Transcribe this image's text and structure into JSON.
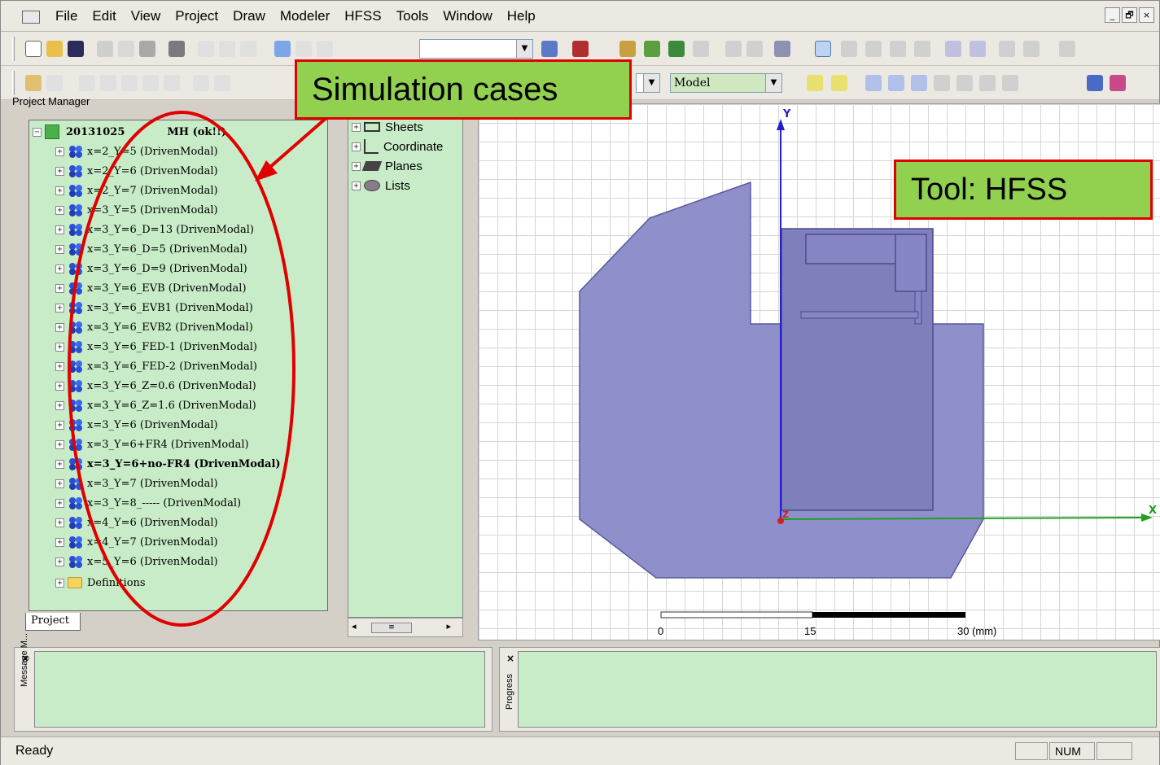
{
  "menubar": {
    "items": [
      "File",
      "Edit",
      "View",
      "Project",
      "Draw",
      "Modeler",
      "HFSS",
      "Tools",
      "Window",
      "Help"
    ],
    "window_controls": [
      "_",
      "🗗",
      "×"
    ]
  },
  "toolbar": {
    "mode_combo": "Model"
  },
  "project_manager": {
    "title": "Project Manager",
    "project_name": "20131025",
    "project_suffix": "MH (ok!!)",
    "cases": [
      "x=2_Y=5 (DrivenModal)",
      "x=2_Y=6 (DrivenModal)",
      "x=2_Y=7 (DrivenModal)",
      "x=3_Y=5 (DrivenModal)",
      "x=3_Y=6_D=13 (DrivenModal)",
      "x=3_Y=6_D=5 (DrivenModal)",
      "x=3_Y=6_D=9 (DrivenModal)",
      "x=3_Y=6_EVB (DrivenModal)",
      "x=3_Y=6_EVB1 (DrivenModal)",
      "x=3_Y=6_EVB2 (DrivenModal)",
      "x=3_Y=6_FED-1 (DrivenModal)",
      "x=3_Y=6_FED-2 (DrivenModal)",
      "x=3_Y=6_Z=0.6 (DrivenModal)",
      "x=3_Y=6_Z=1.6 (DrivenModal)",
      "x=3_Y=6 (DrivenModal)",
      "x=3_Y=6+FR4 (DrivenModal)",
      "x=3_Y=6+no-FR4 (DrivenModal)",
      "x=3_Y=7 (DrivenModal)",
      "x=3_Y=8_----- (DrivenModal)",
      "x=4_Y=6 (DrivenModal)",
      "x=4_Y=7 (DrivenModal)",
      "x=5_Y=6 (DrivenModal)"
    ],
    "active_case_index": 16,
    "definitions": "Definitions",
    "tab": "Project"
  },
  "model_tree": {
    "items": [
      "Sheets",
      "Coordinate",
      "Planes",
      "Lists"
    ]
  },
  "canvas": {
    "axis_y": "Y",
    "axis_x": "X",
    "axis_z": "Z",
    "scale_labels": [
      "0",
      "15",
      "30 (mm)"
    ]
  },
  "bottom": {
    "message_label": "Message M...",
    "progress_label": "Progress"
  },
  "status": {
    "text": "Ready",
    "num": "NUM"
  },
  "callouts": {
    "simulation": "Simulation cases",
    "tool": "Tool: HFSS"
  },
  "colors": {
    "panel_green": "#c8ecc8",
    "callout_fill": "#92d050",
    "callout_border": "#e00000",
    "model_fill": "#8f8fcc"
  }
}
